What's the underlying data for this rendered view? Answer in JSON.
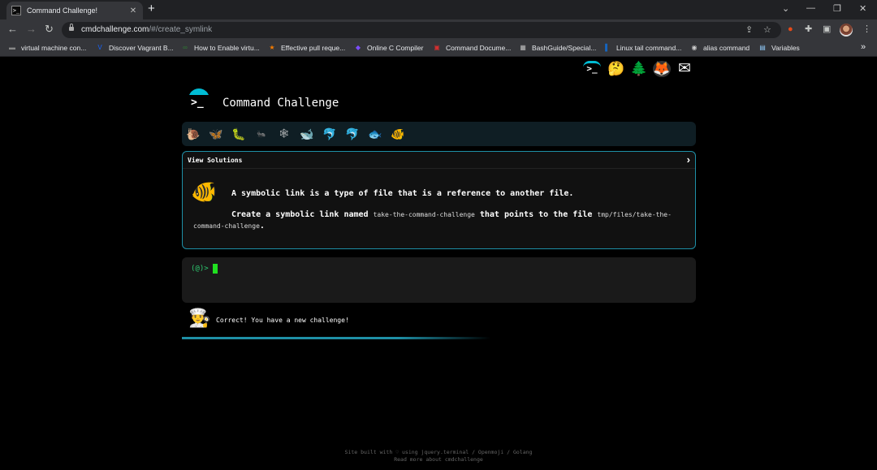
{
  "browser": {
    "tab": {
      "favicon": ">_",
      "title": "Command Challenge!",
      "close": "✕"
    },
    "newtab": "+",
    "window_controls": {
      "dropdown": "⌄",
      "minimize": "—",
      "restore": "❐",
      "close": "✕"
    },
    "nav": {
      "back": "←",
      "forward": "→",
      "reload": "↻"
    },
    "address": {
      "host": "cmdchallenge.com",
      "path": "/#/create_symlink"
    },
    "bookmarks": [
      {
        "label": "virtual machine con...",
        "icon": "▬",
        "color": "#888888"
      },
      {
        "label": "Discover Vagrant B...",
        "icon": "V",
        "color": "#1563ff"
      },
      {
        "label": "How to Enable virtu...",
        "icon": "∞",
        "color": "#2e7d32"
      },
      {
        "label": "Effective pull reque...",
        "icon": "★",
        "color": "#f57c00"
      },
      {
        "label": "Online C Compiler",
        "icon": "◆",
        "color": "#7c4dff"
      },
      {
        "label": "Command Docume...",
        "icon": "▣",
        "color": "#d32f2f"
      },
      {
        "label": "BashGuide/Special...",
        "icon": "▦",
        "color": "#bbbbbb"
      },
      {
        "label": "Linux tail command...",
        "icon": "▌",
        "color": "#1565c0"
      },
      {
        "label": "alias command",
        "icon": "◉",
        "color": "#cccccc"
      },
      {
        "label": "Variables",
        "icon": "▤",
        "color": "#90caf9"
      }
    ],
    "bookmarks_overflow": "»"
  },
  "page": {
    "header_icons": [
      {
        "name": "terminal-icon",
        "glyph": ">_"
      },
      {
        "name": "thinking-emoji-icon",
        "glyph": "🤔"
      },
      {
        "name": "tree-icon",
        "glyph": "🌲"
      },
      {
        "name": "gitlab-icon",
        "glyph": "🦊"
      },
      {
        "name": "mail-icon",
        "glyph": "✉"
      }
    ],
    "logo_glyph": ">_",
    "title": "Command Challenge",
    "animals": [
      "🐌",
      "🦋",
      "🐛",
      "🐜",
      "🕸",
      "🐋",
      "🐬",
      "🐬",
      "🐟",
      "🐠"
    ],
    "challenge": {
      "header": "View Solutions",
      "chevron": "›",
      "icon": "🐠",
      "line1": "A symbolic link is a type of file that is a reference to another file.",
      "line2_a": "Create a symbolic link named",
      "code1": "take-the-command-challenge",
      "line2_b": "that points to the file",
      "code2": "tmp/files/take-the-command-challenge",
      "line2_c": "."
    },
    "terminal": {
      "prompt": "(@)>"
    },
    "status": {
      "icon": "👨‍🍳",
      "message": "Correct! You have a new challenge!"
    },
    "footer": {
      "line1": "Site built with ♡ using jquery.terminal / Openmoji / Golang",
      "line2": "Read more about cmdchallenge"
    }
  }
}
